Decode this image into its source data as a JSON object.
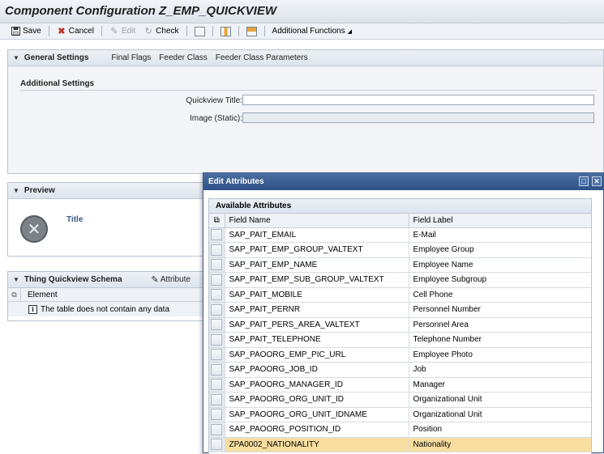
{
  "title": "Component Configuration Z_EMP_QUICKVIEW",
  "toolbar": {
    "save": "Save",
    "cancel": "Cancel",
    "edit": "Edit",
    "check": "Check",
    "additional": "Additional Functions"
  },
  "general": {
    "header": "General Settings",
    "links": [
      "Final Flags",
      "Feeder Class",
      "Feeder Class Parameters"
    ],
    "section": "Additional Settings",
    "quickview_title_label": "Quickview Title:",
    "image_label": "Image (Static):"
  },
  "preview": {
    "header": "Preview",
    "title": "Title"
  },
  "schema": {
    "header": "Thing Quickview Schema",
    "attribute_button": "Attribute",
    "column": "Element",
    "empty_text": "The table does not contain any data"
  },
  "dialog": {
    "title": "Edit Attributes",
    "panel_header": "Available Attributes",
    "col_field_name": "Field Name",
    "col_field_label": "Field Label",
    "rows": [
      {
        "name": "SAP_PAIT_EMAIL",
        "label": "E-Mail"
      },
      {
        "name": "SAP_PAIT_EMP_GROUP_VALTEXT",
        "label": "Employee Group"
      },
      {
        "name": "SAP_PAIT_EMP_NAME",
        "label": "Employee Name"
      },
      {
        "name": "SAP_PAIT_EMP_SUB_GROUP_VALTEXT",
        "label": "Employee Subgroup"
      },
      {
        "name": "SAP_PAIT_MOBILE",
        "label": "Cell Phone"
      },
      {
        "name": "SAP_PAIT_PERNR",
        "label": "Personnel Number"
      },
      {
        "name": "SAP_PAIT_PERS_AREA_VALTEXT",
        "label": "Personnel Area"
      },
      {
        "name": "SAP_PAIT_TELEPHONE",
        "label": "Telephone Number"
      },
      {
        "name": "SAP_PAOORG_EMP_PIC_URL",
        "label": "Employee Photo"
      },
      {
        "name": "SAP_PAOORG_JOB_ID",
        "label": "Job"
      },
      {
        "name": "SAP_PAOORG_MANAGER_ID",
        "label": "Manager"
      },
      {
        "name": "SAP_PAOORG_ORG_UNIT_ID",
        "label": "Organizational Unit"
      },
      {
        "name": "SAP_PAOORG_ORG_UNIT_IDNAME",
        "label": "Organizational Unit"
      },
      {
        "name": "SAP_PAOORG_POSITION_ID",
        "label": "Position"
      },
      {
        "name": "ZPA0002_NATIONALITY",
        "label": "Nationality"
      }
    ],
    "highlighted_row": 14
  },
  "colors": {
    "highlight": "#f7dea0",
    "dialog_title": "#2e5288"
  }
}
